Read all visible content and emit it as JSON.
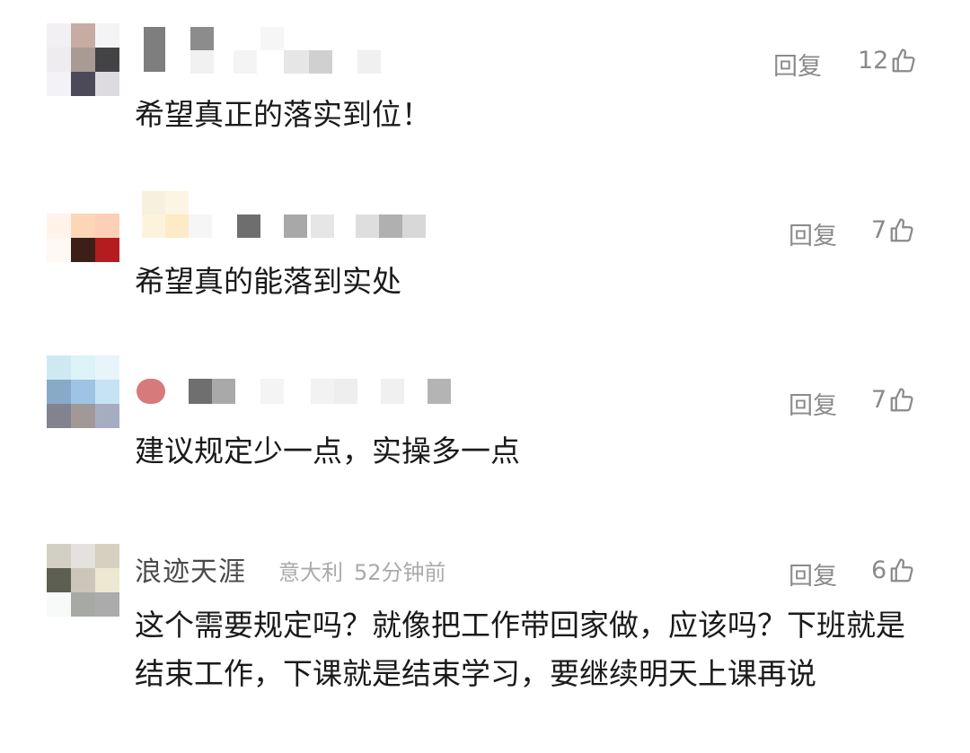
{
  "reply_label": "回复",
  "colors": {
    "text": "#1a1a1a",
    "meta": "#aaaaaa",
    "action": "#8a8a8a"
  },
  "comments": [
    {
      "likes": "12",
      "text": "希望真正的落实到位！"
    },
    {
      "likes": "7",
      "text": "希望真的能落到实处"
    },
    {
      "likes": "7",
      "text": "建议规定少一点，实操多一点"
    },
    {
      "username": "浪迹天涯",
      "location": "意大利",
      "time": "52分钟前",
      "likes": "6",
      "text": "这个需要规定吗？就像把工作带回家做，应该吗？下班就是结束工作，下课就是结束学习，要继续明天上课再说"
    }
  ],
  "icons": {
    "like": "thumbs-up-icon"
  }
}
